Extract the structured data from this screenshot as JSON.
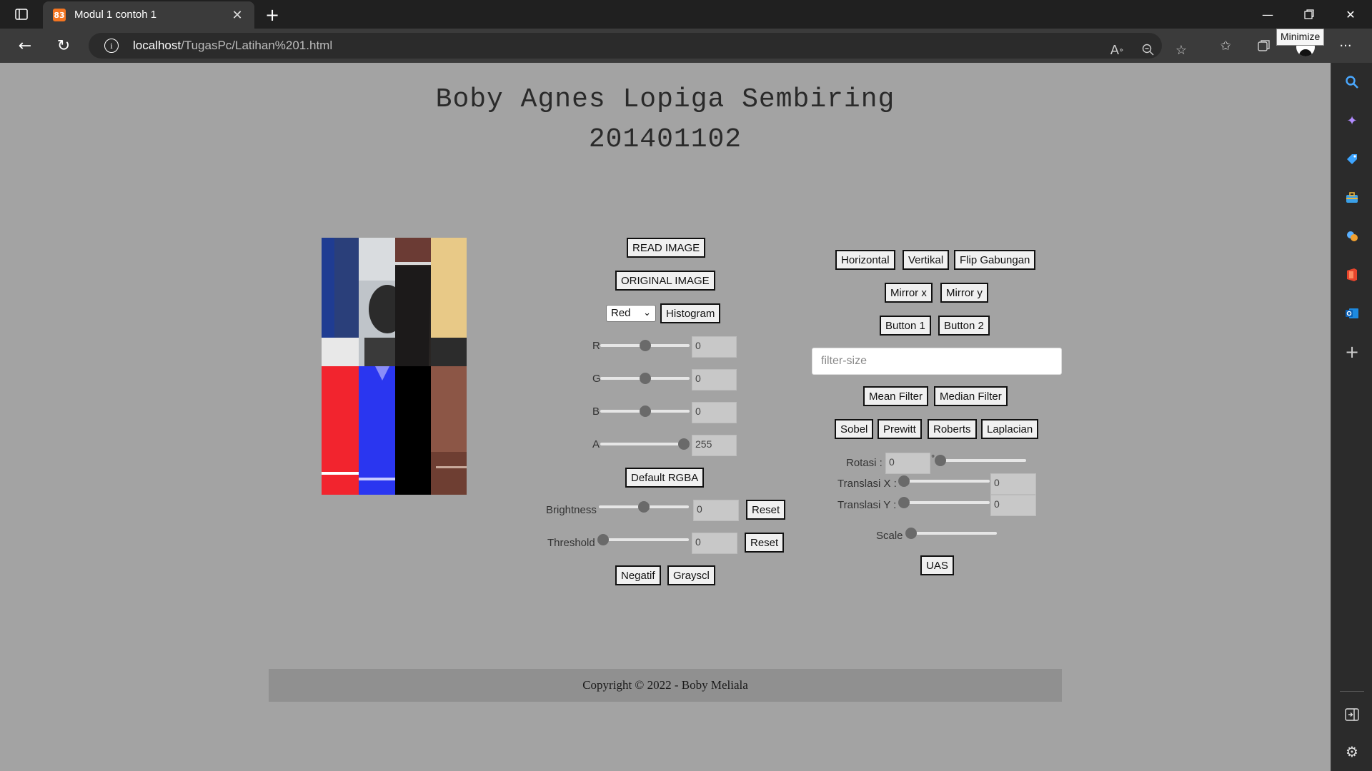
{
  "browser": {
    "tab_title": "Modul 1 contoh 1",
    "url_host": "localhost",
    "url_path": "/TugasPc/Latihan%201.html",
    "tooltip": "Minimize",
    "favicon_text": "83"
  },
  "header": {
    "name": "Boby Agnes Lopiga Sembiring",
    "nim": "201401102"
  },
  "controls": {
    "read_image": "READ IMAGE",
    "original_image": "ORIGINAL IMAGE",
    "channel_selected": "Red",
    "histogram": "Histogram",
    "r_label": "R",
    "g_label": "G",
    "b_label": "B",
    "a_label": "A",
    "r_value": "0",
    "g_value": "0",
    "b_value": "0",
    "a_value": "255",
    "default_rgba": "Default RGBA",
    "brightness_label": "Brightness",
    "brightness_value": "0",
    "threshold_label": "Threshold",
    "threshold_value": "0",
    "reset": "Reset",
    "negatif": "Negatif",
    "grayscl": "Grayscl"
  },
  "transform": {
    "horizontal": "Horizontal",
    "vertikal": "Vertikal",
    "flip_gabungan": "Flip Gabungan",
    "mirror_x": "Mirror x",
    "mirror_y": "Mirror y",
    "button1": "Button 1",
    "button2": "Button 2",
    "filter_placeholder": "filter-size",
    "mean_filter": "Mean Filter",
    "median_filter": "Median Filter",
    "sobel": "Sobel",
    "prewitt": "Prewitt",
    "roberts": "Roberts",
    "laplacian": "Laplacian",
    "rotasi_label": "Rotasi :",
    "rotasi_value": "0",
    "degree": "°",
    "translasi_x_label": "Translasi X :",
    "translasi_x_value": "0",
    "translasi_y_label": "Translasi Y :",
    "translasi_y_value": "0",
    "scale_label": "Scale",
    "uas": "UAS"
  },
  "footer": {
    "copyright": "Copyright © 2022 - Boby Meliala"
  },
  "colors": {
    "page_bg": "#a3a3a3",
    "footer_bg": "#909090",
    "chrome_bg": "#202020"
  },
  "icons": [
    "tab-actions-icon",
    "close-tab-icon",
    "new-tab-icon",
    "back-icon",
    "refresh-icon",
    "info-icon",
    "read-aloud-icon",
    "zoom-icon",
    "add-favorite-icon",
    "favorites-icon",
    "collections-icon",
    "profile-icon",
    "more-icon",
    "search-icon",
    "copilot-icon",
    "shopping-icon",
    "tools-icon",
    "games-icon",
    "office-icon",
    "outlook-icon",
    "add-icon",
    "sidebar-toggle-icon",
    "settings-icon"
  ]
}
